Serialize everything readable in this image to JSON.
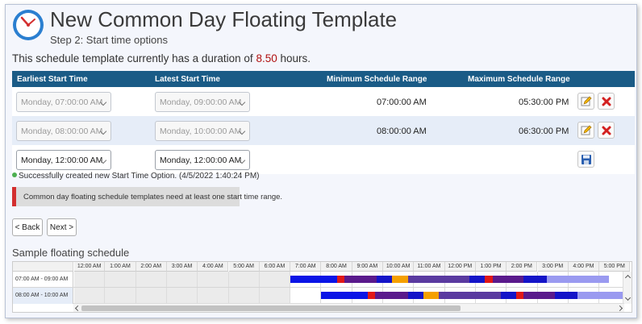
{
  "header": {
    "title": "New Common Day Floating Template",
    "subtitle": "Step 2: Start time options"
  },
  "duration": {
    "prefix": "This schedule template currently has a duration of",
    "hours": "8.50",
    "suffix": "hours."
  },
  "table": {
    "columns": [
      "Earliest Start Time",
      "Latest Start Time",
      "Minimum Schedule Range",
      "Maximum Schedule Range"
    ],
    "rows": [
      {
        "earliest": "Monday, 07:00:00 AM",
        "latest": "Monday, 09:00:00 AM",
        "min_range": "07:00:00 AM",
        "max_range": "05:30:00 PM"
      },
      {
        "earliest": "Monday, 08:00:00 AM",
        "latest": "Monday, 10:00:00 AM",
        "min_range": "08:00:00 AM",
        "max_range": "06:30:00 PM"
      }
    ],
    "new_row": {
      "earliest": "Monday, 12:00:00 AM",
      "latest": "Monday, 12:00:00 AM"
    }
  },
  "messages": {
    "success": "Successfully created new Start Time Option. (4/5/2022 1:40:24 PM)",
    "error": "Common day floating schedule templates need at least one start time range."
  },
  "buttons": {
    "back": "< Back",
    "next": "Next >"
  },
  "icons": {
    "edit": "edit-icon",
    "delete": "delete-icon",
    "save": "save-icon",
    "logo": "clock-icon"
  },
  "sample": {
    "title": "Sample floating schedule",
    "hours": [
      "12:00 AM",
      "1:00 AM",
      "2:00 AM",
      "3:00 AM",
      "4:00 AM",
      "5:00 AM",
      "6:00 AM",
      "7:00 AM",
      "8:00 AM",
      "9:00 AM",
      "10:00 AM",
      "11:00 AM",
      "12:00 PM",
      "1:00 PM",
      "2:00 PM",
      "3:00 PM",
      "4:00 PM",
      "5:00 PM"
    ],
    "rows": [
      {
        "label": "07:00 AM - 09:00 AM",
        "segments": [
          {
            "start": 7.0,
            "end": 8.5,
            "color": "#0a14e6"
          },
          {
            "start": 8.5,
            "end": 8.75,
            "color": "#e01818"
          },
          {
            "start": 8.75,
            "end": 9.8,
            "color": "#5a1a8c"
          },
          {
            "start": 9.8,
            "end": 10.3,
            "color": "#1414c8"
          },
          {
            "start": 10.3,
            "end": 10.8,
            "color": "#f5a000"
          },
          {
            "start": 10.8,
            "end": 12.8,
            "color": "#5a3aa0"
          },
          {
            "start": 12.8,
            "end": 13.3,
            "color": "#1414c8"
          },
          {
            "start": 13.3,
            "end": 13.55,
            "color": "#e01818"
          },
          {
            "start": 13.55,
            "end": 14.55,
            "color": "#5a1a8c"
          },
          {
            "start": 14.55,
            "end": 15.3,
            "color": "#1414c8"
          },
          {
            "start": 15.3,
            "end": 17.3,
            "color": "#9a9af0"
          }
        ]
      },
      {
        "label": "08:00 AM - 10:00 AM",
        "segments": [
          {
            "start": 8.0,
            "end": 9.5,
            "color": "#0a14e6"
          },
          {
            "start": 9.5,
            "end": 9.75,
            "color": "#e01818"
          },
          {
            "start": 9.75,
            "end": 10.8,
            "color": "#5a1a8c"
          },
          {
            "start": 10.8,
            "end": 11.3,
            "color": "#1414c8"
          },
          {
            "start": 11.3,
            "end": 11.8,
            "color": "#f5a000"
          },
          {
            "start": 11.8,
            "end": 13.8,
            "color": "#5a3aa0"
          },
          {
            "start": 13.8,
            "end": 14.3,
            "color": "#1414c8"
          },
          {
            "start": 14.3,
            "end": 14.55,
            "color": "#e01818"
          },
          {
            "start": 14.55,
            "end": 15.55,
            "color": "#5a1a8c"
          },
          {
            "start": 15.55,
            "end": 16.3,
            "color": "#1414c8"
          },
          {
            "start": 16.3,
            "end": 18.3,
            "color": "#9a9af0"
          }
        ]
      }
    ],
    "shaded_hours": [
      0,
      6
    ]
  }
}
